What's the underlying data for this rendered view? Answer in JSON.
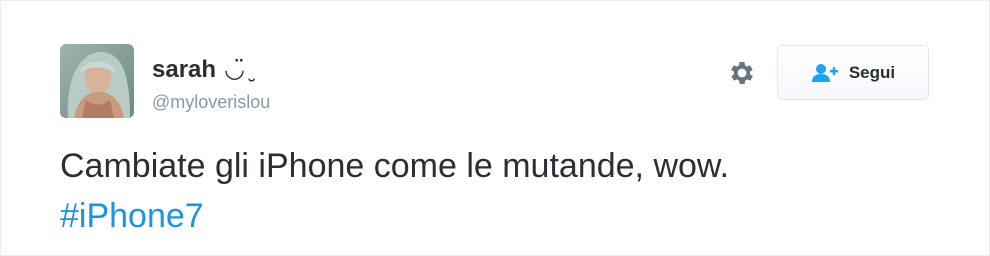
{
  "user": {
    "name": "sarah",
    "emoticon": "◡̈ ̮",
    "handle": "@myloverislou"
  },
  "actions": {
    "settings_icon": "gear-icon",
    "follow_icon": "user-plus-icon",
    "follow_label": "Segui"
  },
  "tweet": {
    "text": "Cambiate gli iPhone come le mutande, wow.",
    "hashtag": "#iPhone7"
  },
  "colors": {
    "text": "#292f33",
    "muted": "#8899a6",
    "link": "#1b95e0",
    "follow_icon": "#1da1f2",
    "gear": "#66757f"
  }
}
